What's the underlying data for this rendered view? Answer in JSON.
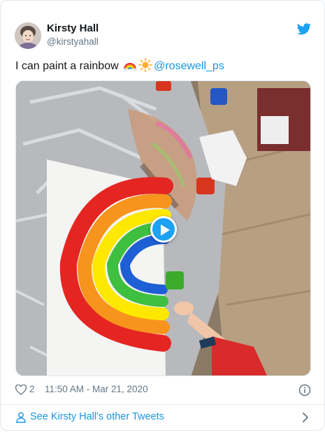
{
  "tweet": {
    "author_name": "Kirsty Hall",
    "author_handle": "@kirstyahall",
    "text": "I can paint a rainbow ",
    "emojis": [
      "rainbow",
      "sun"
    ],
    "mention": "@rosewell_ps",
    "media": {
      "type": "video",
      "icon": "play-icon",
      "description_colors": [
        "#e52521",
        "#f7941d",
        "#ffe800",
        "#3fbf3f",
        "#1f5fd6"
      ]
    },
    "likes": "2",
    "timestamp": "11:50 AM - Mar 21, 2020"
  },
  "footer": {
    "see_more_label": "See Kirsty Hall's other Tweets"
  },
  "colors": {
    "link": "#1b95e0",
    "twitter_blue": "#1da1f2",
    "muted": "#657786",
    "border": "#e1e8ed"
  }
}
